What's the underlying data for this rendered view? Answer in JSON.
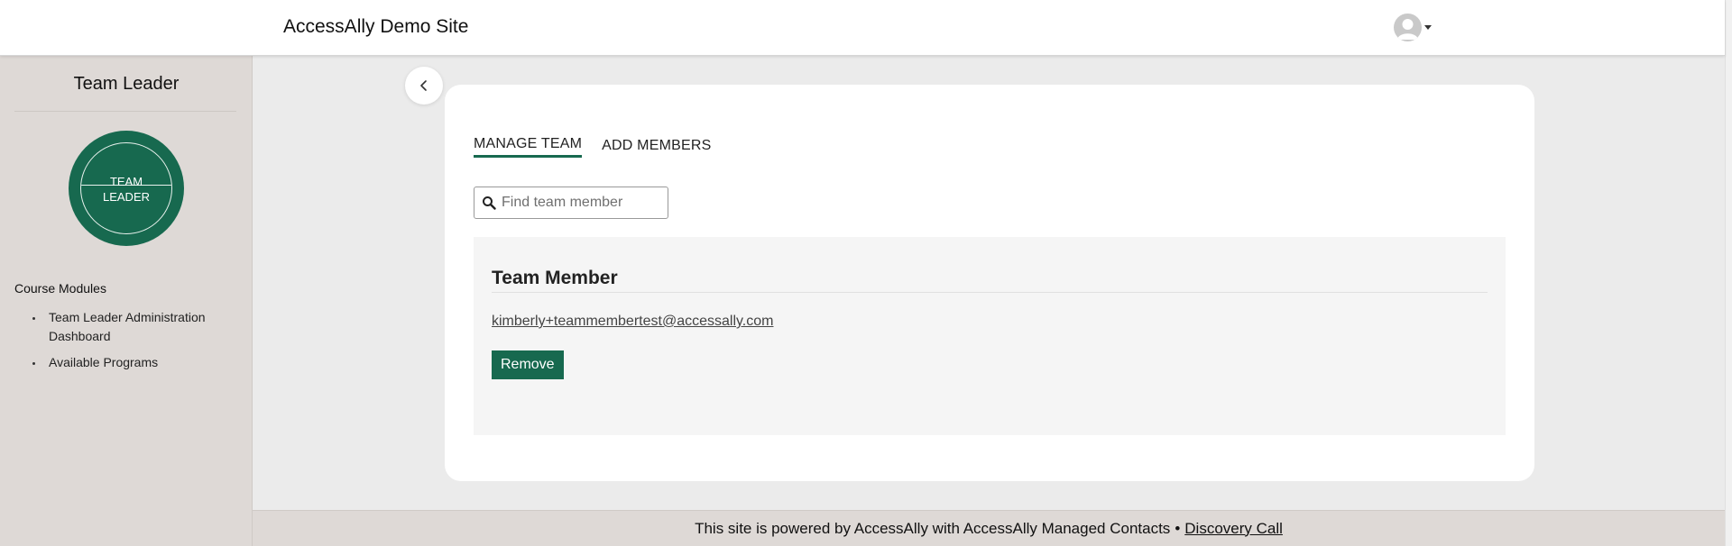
{
  "header": {
    "site_title": "AccessAlly Demo Site",
    "avatar_icon": "user-avatar-icon",
    "menu_icon": "caret-down-icon"
  },
  "sidebar": {
    "title": "Team Leader",
    "badge": {
      "line1": "TEAM",
      "line2": "LEADER",
      "color": "#17694f"
    },
    "section_label": "Course Modules",
    "items": [
      {
        "label": "Team Leader Administration Dashboard"
      },
      {
        "label": "Available Programs"
      }
    ]
  },
  "main": {
    "collapse_icon": "chevron-left-icon",
    "tabs": [
      {
        "label": "MANAGE TEAM",
        "active": true
      },
      {
        "label": "ADD MEMBERS",
        "active": false
      }
    ],
    "search": {
      "placeholder": "Find team member",
      "value": "",
      "icon": "search-icon"
    },
    "panel": {
      "title": "Team Member",
      "email": "kimberly+teammembertest@accessally.com",
      "remove_label": "Remove"
    }
  },
  "footer": {
    "text": "This site is powered by AccessAlly with AccessAlly Managed Contacts",
    "separator": "•",
    "link_label": "Discovery Call"
  },
  "colors": {
    "accent": "#17694f",
    "sidebar_bg": "#ded9d6",
    "page_bg": "#ebebeb"
  }
}
